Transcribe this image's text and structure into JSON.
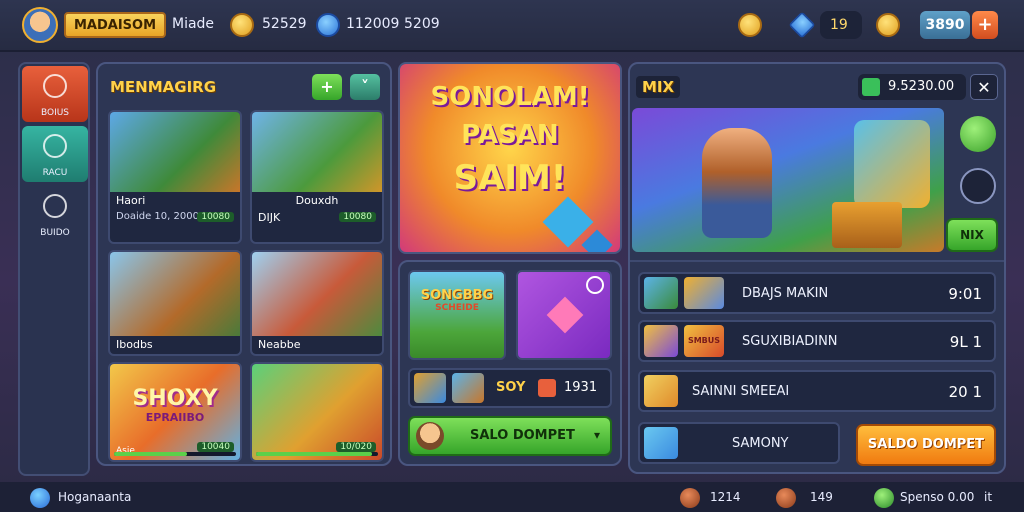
{
  "topbar": {
    "player_name": "MADAISOM",
    "mode": "Miade",
    "coins": "52529",
    "gems_a": "112009",
    "gems_b": "5209",
    "counter": "19",
    "gold_value": "3890",
    "add_label": "+"
  },
  "sidenav": {
    "items": [
      {
        "label": "BOIUS",
        "color": "#d9482a"
      },
      {
        "label": "RACU",
        "color": "#2a9a8a"
      },
      {
        "label": "BUIDO",
        "color": "#2a3350"
      }
    ]
  },
  "left_panel": {
    "title": "MENMAGIRG",
    "add_label": "+",
    "collapse_label": "˅",
    "cards": [
      {
        "caption": "Haori",
        "sub": "Doaide 10, 20000",
        "tag": "10080",
        "progress": 0.0
      },
      {
        "caption": "DIJK",
        "sub": "Douxdh",
        "tag": "10080",
        "progress": 0.0
      },
      {
        "caption": "Ibodbs",
        "sub": "",
        "tag": "",
        "progress": 0.0
      },
      {
        "caption": "Neabbe",
        "sub": "",
        "tag": "",
        "progress": 0.0
      },
      {
        "caption": "Asie",
        "sub": "",
        "tag": "10040",
        "progress": 0.6
      },
      {
        "caption": "",
        "sub": "",
        "tag": "10/020",
        "progress": 0.95
      }
    ],
    "logo_text": "SHOXY",
    "logo_sub": "EPRAIIBO"
  },
  "banner": {
    "line1": "SONOLAM!",
    "line2": "PASAN",
    "line3": "SAIM!"
  },
  "middle_panel": {
    "shop_logo": "SONGBBG",
    "shop_logo_sub": "SCHEIDE",
    "small_label": "SOY",
    "small_value": "1931",
    "action_label": "SALO DOMPET"
  },
  "right_panel": {
    "title": "MIX",
    "balance": "9.5230.00",
    "close_label": "✕",
    "side_button": "NIX",
    "rows": [
      {
        "name": "DBAJS MAKIN",
        "value": "9:01"
      },
      {
        "name": "SGUXIBIADINN",
        "value": "9L 1"
      },
      {
        "name": "SAINNI SMEEAI",
        "value": "20 1"
      },
      {
        "name": "SAMONY",
        "value": ""
      }
    ],
    "row2_logo": "SMBUS",
    "action_label": "SALDO DOMPET"
  },
  "bottombar": {
    "left_label": "Hoganaanta",
    "stat1": "1214",
    "stat2": "149",
    "stat3": "Spenso 0.00",
    "stat3_suffix": "it"
  }
}
